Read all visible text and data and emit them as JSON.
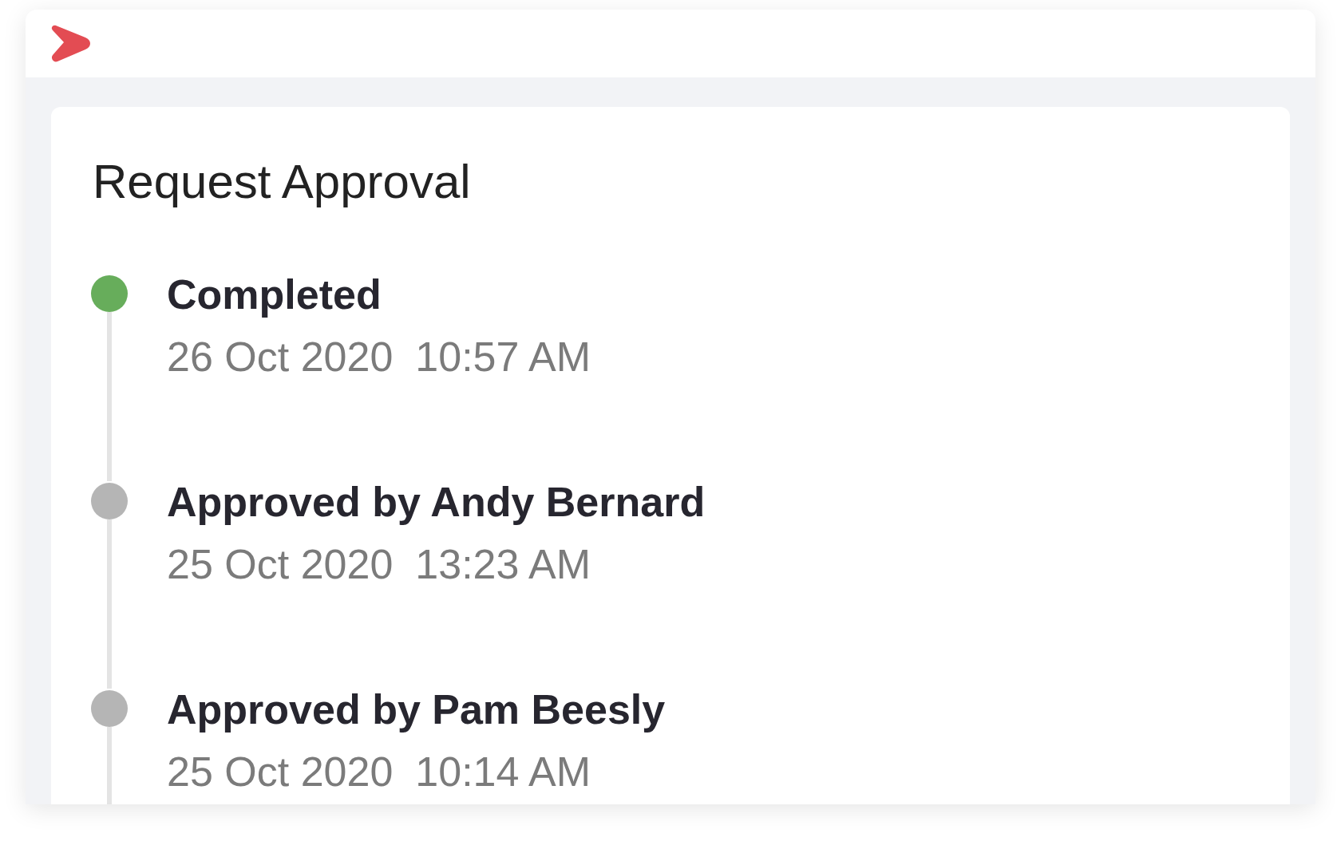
{
  "card": {
    "title": "Request Approval",
    "steps": [
      {
        "title": "Completed",
        "date": "26 Oct 2020",
        "time": "10:57 AM",
        "color": "#67ad5b"
      },
      {
        "title": "Approved by Andy Bernard",
        "date": "25 Oct 2020",
        "time": "13:23 AM",
        "color": "#b5b5b5"
      },
      {
        "title": "Approved by Pam Beesly",
        "date": "25 Oct 2020",
        "time": "10:14 AM",
        "color": "#b5b5b5"
      }
    ]
  }
}
